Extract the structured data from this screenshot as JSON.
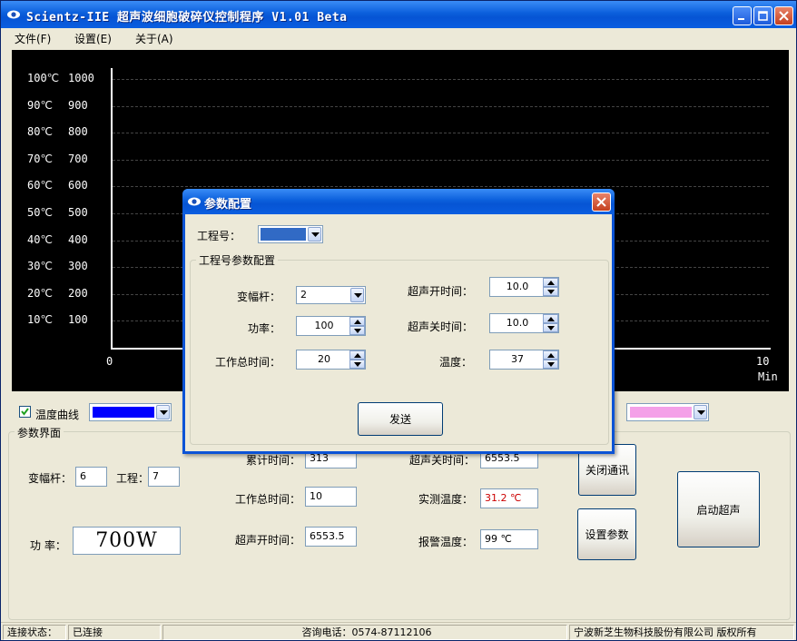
{
  "window": {
    "title": "Scientz-IIE 超声波细胞破碎仪控制程序 V1.01 Beta"
  },
  "menu": [
    "文件(F)",
    "设置(E)",
    "关于(A)"
  ],
  "chart_data": {
    "type": "line",
    "y_labels_temp": [
      "100℃",
      "90℃",
      "80℃",
      "70℃",
      "60℃",
      "50℃",
      "40℃",
      "30℃",
      "20℃",
      "10℃"
    ],
    "y_labels_power": [
      "1000",
      "900",
      "800",
      "700",
      "600",
      "500",
      "400",
      "300",
      "200",
      "100"
    ],
    "x_ticks": [
      "0",
      "10"
    ],
    "xlabel": "Min",
    "xlim": [
      0,
      10
    ],
    "ylim_temp": [
      0,
      100
    ],
    "ylim_power": [
      0,
      1000
    ],
    "series": [],
    "grid": true
  },
  "controls": {
    "temp_curve_label": "温度曲线",
    "temp_curve_color": "#0000ff",
    "power_curve_color": "#f4a0e8"
  },
  "params": {
    "group_title": "参数界面",
    "horn_label": "变幅杆：",
    "horn_value": "6",
    "project_label": "工程：",
    "project_value": "7",
    "power_label": "功  率：",
    "power_value": "700W",
    "accum_time_label": "累计时间：",
    "accum_time_value": "313",
    "total_time_label": "工作总时间：",
    "total_time_value": "10",
    "on_time_label": "超声开时间：",
    "on_time_value": "6553.5",
    "off_time_label": "超声关时间：",
    "off_time_value": "6553.5",
    "measured_temp_label": "实测温度：",
    "measured_temp_value": "31.2 ℃",
    "alarm_temp_label": "报警温度：",
    "alarm_temp_value": "99 ℃",
    "close_comm_button": "关闭通讯",
    "set_params_button": "设置参数",
    "start_ultrasonic_button": "启动超声"
  },
  "status": {
    "conn_label": "连接状态：",
    "conn_value": "已连接",
    "phone": "咨询电话：0574-87112106",
    "company": "宁波新芝生物科技股份有限公司 版权所有"
  },
  "dialog": {
    "title": "参数配置",
    "project_no_label": "工程号：",
    "group_title": "工程号参数配置",
    "horn_label": "变幅杆：",
    "horn_value": "2",
    "power_label": "功率：",
    "power_value": "100",
    "total_time_label": "工作总时间：",
    "total_time_value": "20",
    "on_time_label": "超声开时间：",
    "on_time_value": "10.0",
    "off_time_label": "超声关时间：",
    "off_time_value": "10.0",
    "temp_label": "温度：",
    "temp_value": "37",
    "send_button": "发送"
  },
  "colors": {
    "title_blue": "#0654d4",
    "measured_temp_red": "#cc0000"
  }
}
